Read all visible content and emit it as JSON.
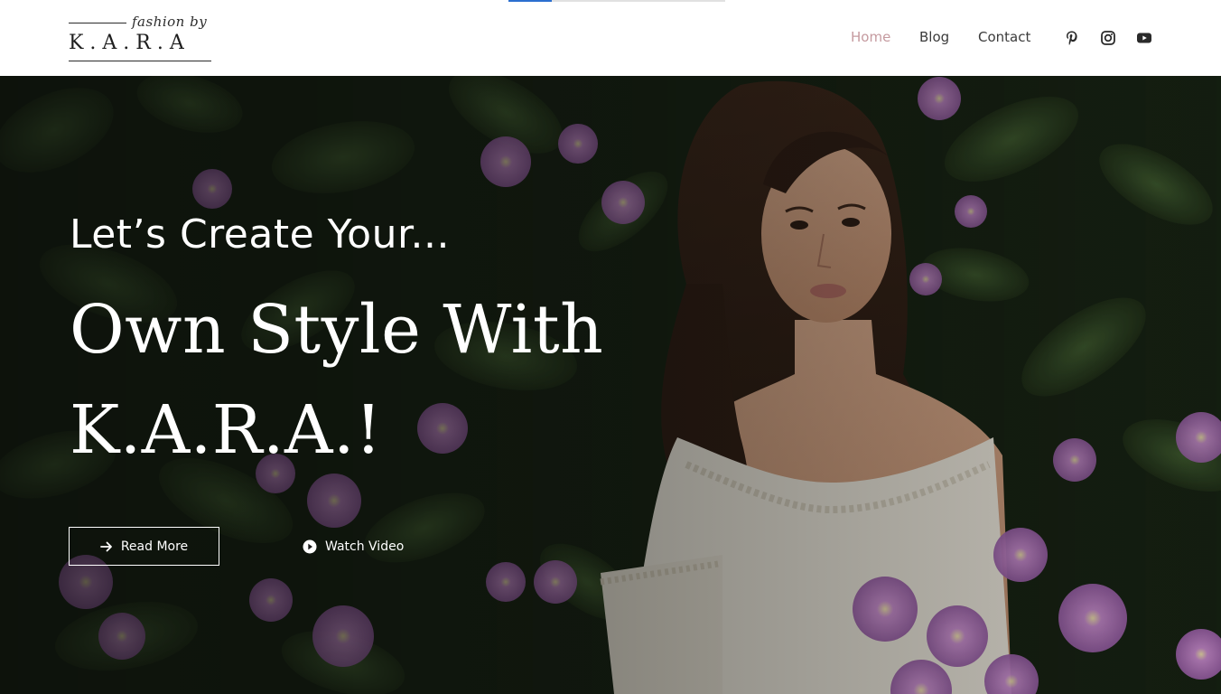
{
  "brand": {
    "logo_script": "fashion by",
    "logo_letters": "K . A . R . A"
  },
  "header": {
    "reading_progress_fraction": 0.2,
    "nav": [
      {
        "label": "Home",
        "active": true
      },
      {
        "label": "Blog",
        "active": false
      },
      {
        "label": "Contact",
        "active": false
      }
    ],
    "social": [
      "pinterest-icon",
      "instagram-icon",
      "youtube-icon"
    ]
  },
  "hero": {
    "eyebrow": "Let’s Create Your...",
    "headline_line1": "Own Style With",
    "headline_line2": "K.A.R.A.!",
    "read_more_label": "Read More",
    "watch_video_label": "Watch Video",
    "photo_description": "woman with long brown hair in white lace top among purple flowers and green leaves"
  },
  "colors": {
    "nav_active": "#c59a9f",
    "nav_text": "#3b3b3b",
    "progress_fill": "#2b6fcf",
    "hero_text": "#ffffff"
  }
}
